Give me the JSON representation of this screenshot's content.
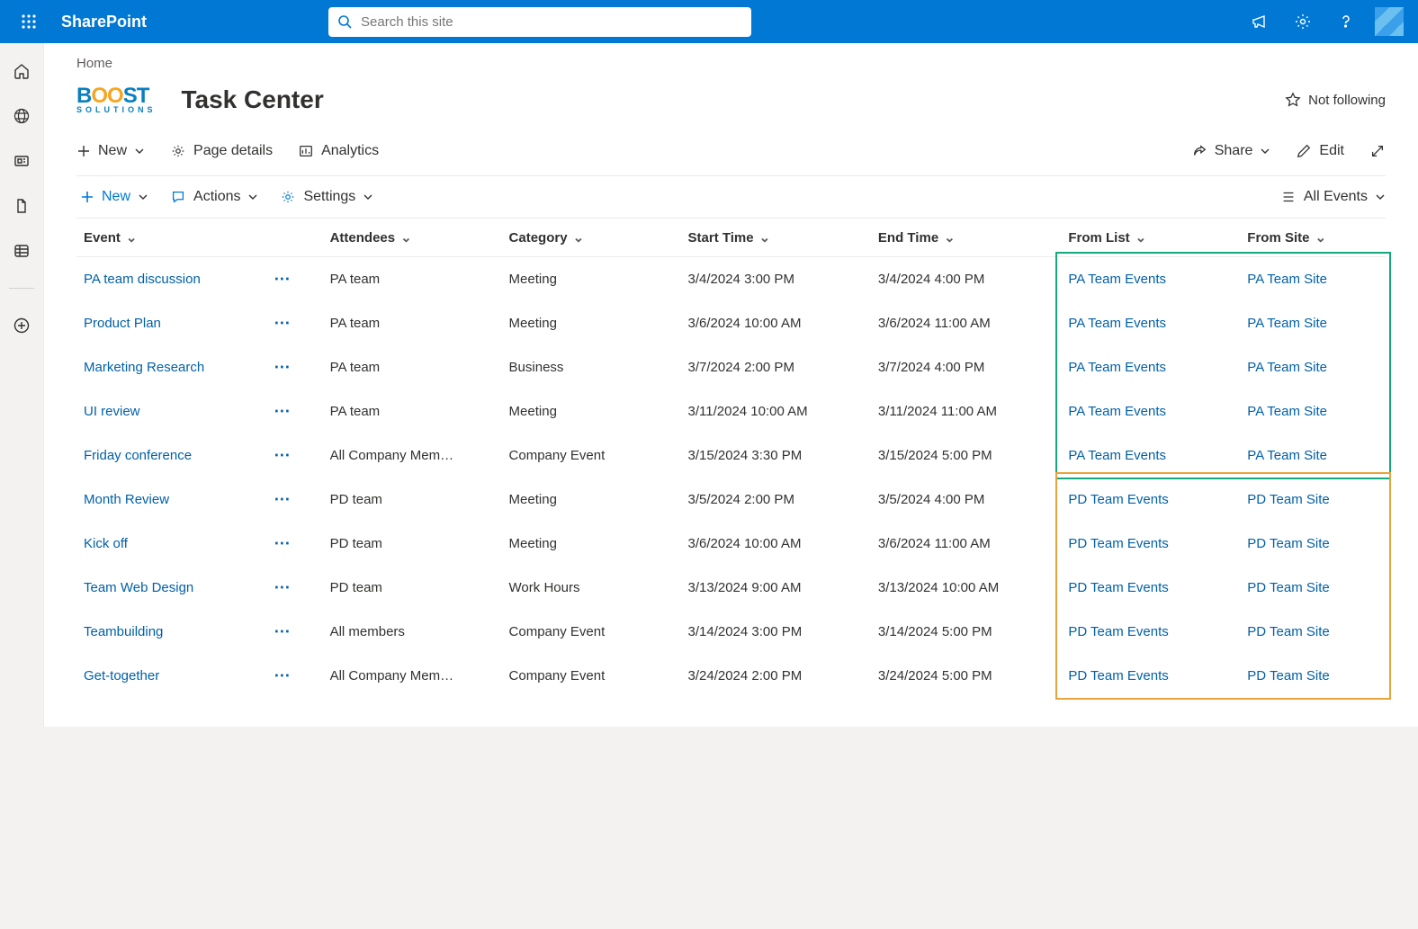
{
  "brand": "SharePoint",
  "search": {
    "placeholder": "Search this site"
  },
  "breadcrumb": "Home",
  "page_title": "Task Center",
  "follow_label": "Not following",
  "cmdbar": {
    "new": "New",
    "page_details": "Page details",
    "analytics": "Analytics",
    "share": "Share",
    "edit": "Edit"
  },
  "toolbar": {
    "new": "New",
    "actions": "Actions",
    "settings": "Settings",
    "view_label": "All Events"
  },
  "columns": {
    "event": "Event",
    "attendees": "Attendees",
    "category": "Category",
    "start": "Start Time",
    "end": "End Time",
    "from_list": "From List",
    "from_site": "From Site"
  },
  "rows": [
    {
      "event": "PA team discussion",
      "attendees": "PA team",
      "category": "Meeting",
      "start": "3/4/2024 3:00 PM",
      "end": "3/4/2024 4:00 PM",
      "from_list": "PA Team Events",
      "from_site": "PA Team Site"
    },
    {
      "event": "Product Plan",
      "attendees": "PA team",
      "category": "Meeting",
      "start": "3/6/2024 10:00 AM",
      "end": "3/6/2024 11:00 AM",
      "from_list": "PA Team Events",
      "from_site": "PA Team Site"
    },
    {
      "event": "Marketing Research",
      "attendees": "PA team",
      "category": "Business",
      "start": "3/7/2024 2:00 PM",
      "end": "3/7/2024 4:00 PM",
      "from_list": "PA Team Events",
      "from_site": "PA Team Site"
    },
    {
      "event": "UI review",
      "attendees": "PA team",
      "category": "Meeting",
      "start": "3/11/2024 10:00 AM",
      "end": "3/11/2024 11:00 AM",
      "from_list": "PA Team Events",
      "from_site": "PA Team Site"
    },
    {
      "event": "Friday conference",
      "attendees": "All Company Mem…",
      "category": "Company Event",
      "start": "3/15/2024 3:30 PM",
      "end": "3/15/2024 5:00 PM",
      "from_list": "PA Team Events",
      "from_site": "PA Team Site"
    },
    {
      "event": "Month Review",
      "attendees": "PD team",
      "category": "Meeting",
      "start": "3/5/2024 2:00 PM",
      "end": "3/5/2024 4:00 PM",
      "from_list": "PD Team Events",
      "from_site": "PD Team Site"
    },
    {
      "event": "Kick off",
      "attendees": "PD team",
      "category": "Meeting",
      "start": "3/6/2024 10:00 AM",
      "end": "3/6/2024 11:00 AM",
      "from_list": "PD Team Events",
      "from_site": "PD Team Site"
    },
    {
      "event": "Team Web Design",
      "attendees": "PD team",
      "category": "Work Hours",
      "start": "3/13/2024 9:00 AM",
      "end": "3/13/2024 10:00 AM",
      "from_list": "PD Team Events",
      "from_site": "PD Team Site"
    },
    {
      "event": "Teambuilding",
      "attendees": "All members",
      "category": "Company Event",
      "start": "3/14/2024 3:00 PM",
      "end": "3/14/2024 5:00 PM",
      "from_list": "PD Team Events",
      "from_site": "PD Team Site"
    },
    {
      "event": "Get-together",
      "attendees": "All Company Mem…",
      "category": "Company Event",
      "start": "3/24/2024 2:00 PM",
      "end": "3/24/2024 5:00 PM",
      "from_list": "PD Team Events",
      "from_site": "PD Team Site"
    }
  ]
}
